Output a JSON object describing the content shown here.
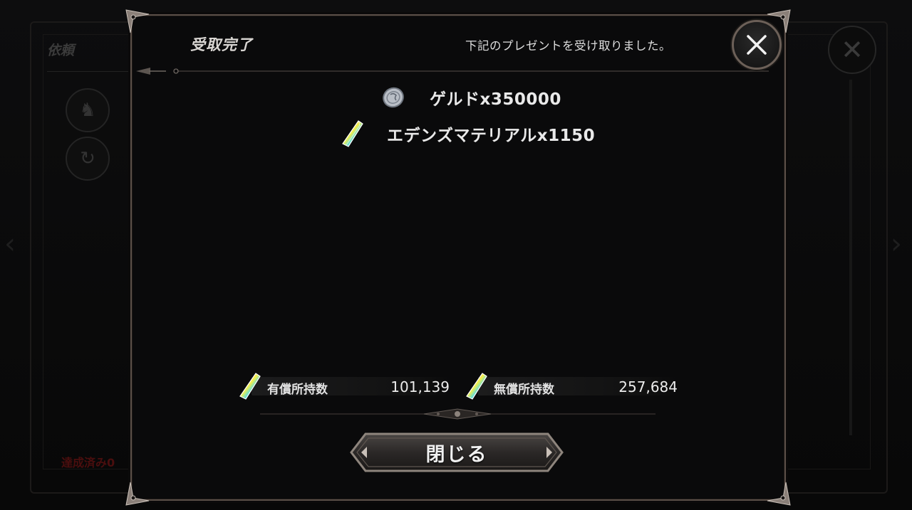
{
  "background": {
    "screen_title": "依頼",
    "status_text": "達成済み0"
  },
  "modal": {
    "title": "受取完了",
    "message": "下記のプレゼントを受け取りました。",
    "close_icon": "close-x-icon",
    "rewards": [
      {
        "icon": "coin-icon",
        "label": "ゲルドx350000"
      },
      {
        "icon": "rainbow-crystal-icon",
        "label": "エデンズマテリアルx1150"
      }
    ],
    "counters": [
      {
        "icon": "rainbow-crystal-icon",
        "label": "有償所持数",
        "value": "101,139"
      },
      {
        "icon": "rainbow-crystal-icon",
        "label": "無償所持数",
        "value": "257,684"
      }
    ],
    "close_button_label": "閉じる"
  }
}
